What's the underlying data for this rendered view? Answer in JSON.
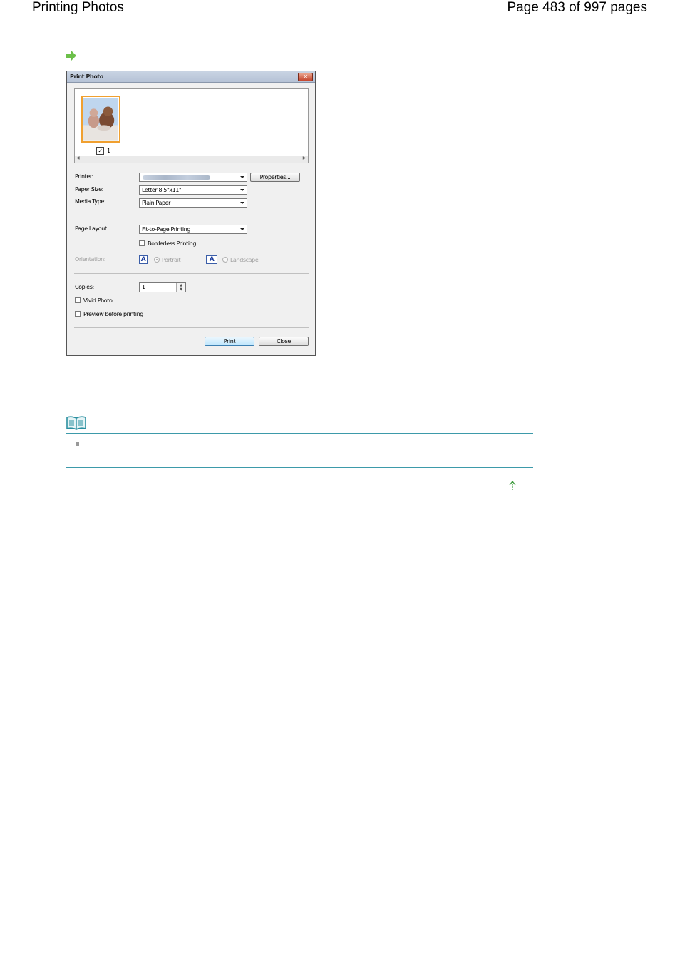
{
  "header": {
    "title": "Printing Photos",
    "page_info": "Page 483 of 997 pages"
  },
  "icons": {
    "step_arrow": "right-arrow-icon",
    "note": "book-icon",
    "back_to_top": "up-arrow-icon"
  },
  "colors": {
    "arrow_green": "#6cc04a",
    "rule_teal": "#3d9aaa",
    "thumb_border": "#f0a030"
  },
  "dialog": {
    "title": "Print Photo",
    "close_glyph": "✕",
    "thumbnail": {
      "checked": true,
      "number": "1"
    },
    "printer_label": "Printer:",
    "properties_button": "Properties...",
    "paper_size_label": "Paper Size:",
    "paper_size_value": "Letter 8.5\"x11\"",
    "media_type_label": "Media Type:",
    "media_type_value": "Plain Paper",
    "page_layout_label": "Page Layout:",
    "page_layout_value": "Fit-to-Page Printing",
    "borderless_label": "Borderless Printing",
    "orientation_label": "Orientation:",
    "portrait_label": "Portrait",
    "landscape_label": "Landscape",
    "orientation_glyph": "A",
    "copies_label": "Copies:",
    "copies_value": "1",
    "vivid_photo_label": "Vivid Photo",
    "preview_label": "Preview before printing",
    "print_button": "Print",
    "close_button": "Close"
  }
}
